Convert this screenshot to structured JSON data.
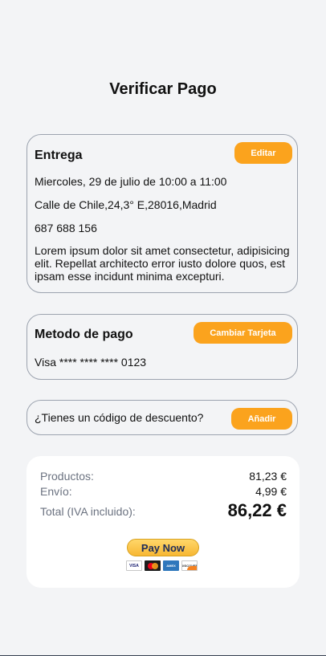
{
  "page": {
    "title": "Verificar Pago"
  },
  "delivery": {
    "heading": "Entrega",
    "edit_label": "Editar",
    "datetime": "Miercoles, 29 de julio de 10:00 a 11:00",
    "address": "Calle de Chile,24,3° E,28016,Madrid",
    "phone": "687 688 156",
    "notes": "Lorem ipsum dolor sit amet consectetur, adipisicing elit. Repellat architecto error iusto dolore quos, est ipsam esse incidunt minima excepturi."
  },
  "payment": {
    "heading": "Metodo de pago",
    "change_label": "Cambiar Tarjeta",
    "card_number": "Visa **** **** **** 0123"
  },
  "discount": {
    "question": "¿Tienes un código de descuento?",
    "add_label": "Añadir"
  },
  "summary": {
    "products_label": "Productos:",
    "products_value": "81,23 €",
    "shipping_label": "Envío:",
    "shipping_value": "4,99 €",
    "total_label": "Total (IVA incluido):",
    "total_value": "86,22 €"
  },
  "checkout": {
    "paynow_label": "Pay Now",
    "card_logos": {
      "visa": "VISA",
      "amex": "AMEX",
      "discover": "DISCOVER"
    }
  },
  "colors": {
    "accent": "#fba31d",
    "background": "#f3f4f6",
    "card_border": "#9ca3af",
    "muted_text": "#6b7280"
  }
}
